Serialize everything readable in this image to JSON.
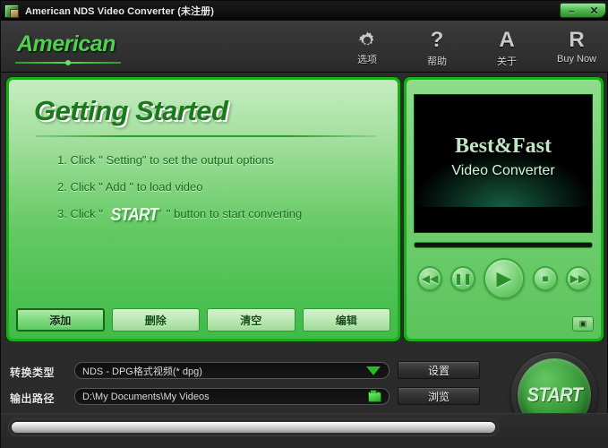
{
  "window": {
    "title": "American NDS Video Converter (未注册)",
    "app_icon": "app-icon",
    "minimize_label": "–",
    "close_label": "✕"
  },
  "header": {
    "logo": "American",
    "toolbar": [
      {
        "icon": "gear-icon",
        "glyph": "",
        "label": "选项"
      },
      {
        "icon": "question-icon",
        "glyph": "?",
        "label": "帮助"
      },
      {
        "icon": "about-a-icon",
        "glyph": "A",
        "label": "关于"
      },
      {
        "icon": "register-r-icon",
        "glyph": "R",
        "label": "Buy Now"
      }
    ]
  },
  "getting_started": {
    "title": "Getting Started",
    "steps": [
      {
        "prefix": "1. Click \" Setting\" to set the output options"
      },
      {
        "prefix": "2. Click \" Add \" to load video"
      },
      {
        "prefix": "3. Click \" ",
        "badge": "START",
        "suffix": " \" button to start converting"
      }
    ]
  },
  "list_buttons": [
    {
      "label": "添加",
      "active": true
    },
    {
      "label": "删除",
      "active": false
    },
    {
      "label": "清空",
      "active": false
    },
    {
      "label": "编辑",
      "active": false
    }
  ],
  "preview": {
    "screen_title": "Best&Fast",
    "screen_subtitle": "Video Converter",
    "transport": [
      {
        "name": "rewind-button",
        "glyph": "◀◀"
      },
      {
        "name": "pause-button",
        "glyph": "❚❚"
      },
      {
        "name": "play-button",
        "glyph": "▶"
      },
      {
        "name": "stop-button",
        "glyph": "■"
      },
      {
        "name": "forward-button",
        "glyph": "▶▶"
      }
    ],
    "snapshot_glyph": "▣"
  },
  "form": {
    "type_label": "转换类型",
    "type_value": "NDS - DPG格式视频(* dpg)",
    "path_label": "输出路径",
    "path_value": "D:\\My Documents\\My Videos",
    "settings_button": "设置",
    "browse_button": "浏览"
  },
  "start": {
    "label": "START"
  },
  "status": {
    "progress_percent": 0
  },
  "colors": {
    "accent_green": "#18b018",
    "panel_light": "#c6ecc2",
    "panel_dark": "#3fbb4a",
    "chrome_dark": "#2b2b2b",
    "title_bar": "#111111"
  }
}
